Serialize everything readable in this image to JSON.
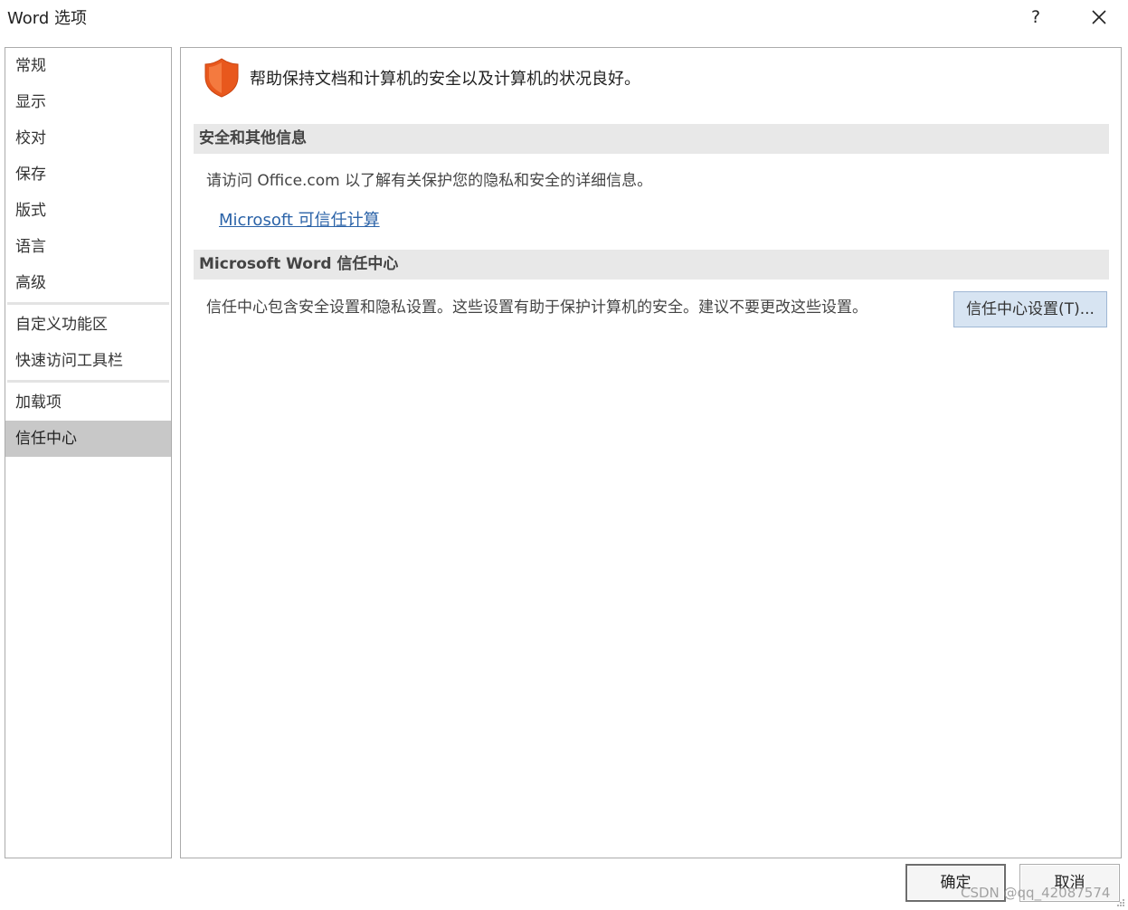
{
  "window": {
    "title": "Word 选项",
    "help": "?"
  },
  "sidebar": {
    "groups": [
      [
        "常规",
        "显示",
        "校对",
        "保存",
        "版式",
        "语言",
        "高级"
      ],
      [
        "自定义功能区",
        "快速访问工具栏"
      ],
      [
        "加载项",
        "信任中心"
      ]
    ],
    "active": "信任中心"
  },
  "main": {
    "intro": "帮助保持文档和计算机的安全以及计算机的状况良好。",
    "security_section": {
      "title": "安全和其他信息",
      "description": "请访问 Office.com 以了解有关保护您的隐私和安全的详细信息。",
      "link": "Microsoft 可信任计算"
    },
    "trust_section": {
      "title": "Microsoft Word 信任中心",
      "description": "信任中心包含安全设置和隐私设置。这些设置有助于保护计算机的安全。建议不要更改这些设置。",
      "button": "信任中心设置(T)..."
    }
  },
  "footer": {
    "ok": "确定",
    "cancel": "取消"
  },
  "watermark": "CSDN @qq_42087574",
  "colors": {
    "shield": "#e8581d",
    "link": "#2b63a8",
    "active_nav": "#c8c8c8",
    "section_header": "#e8e8e8",
    "trust_button": "#d7e4f2"
  }
}
